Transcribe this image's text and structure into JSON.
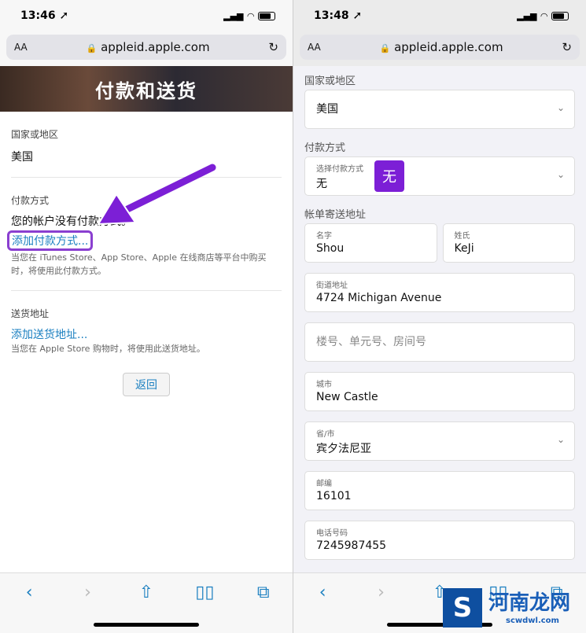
{
  "left": {
    "status": {
      "time": "13:46 ➚"
    },
    "url": {
      "aa": "AA",
      "domain": "appleid.apple.com"
    },
    "banner": "付款和送货",
    "country": {
      "label": "国家或地区",
      "value": "美国"
    },
    "payment": {
      "label": "付款方式",
      "empty": "您的帐户没有付款方式。",
      "add_link": "添加付款方式...",
      "note": "当您在 iTunes Store、App Store、Apple 在线商店等平台中购买时，将使用此付款方式。"
    },
    "shipping": {
      "label": "送货地址",
      "add_link": "添加送货地址...",
      "note": "当您在 Apple Store 购物时，将使用此送货地址。"
    },
    "back_button": "返回",
    "annotation_color": "#8a2be2"
  },
  "right": {
    "status": {
      "time": "13:48 ➚"
    },
    "url": {
      "aa": "AA",
      "domain": "appleid.apple.com"
    },
    "country": {
      "label": "国家或地区",
      "value": "美国"
    },
    "payment": {
      "label": "付款方式",
      "select_label": "选择付款方式",
      "value": "无",
      "badge": "无"
    },
    "billing": {
      "label": "帐单寄送地址",
      "first_name": {
        "label": "名字",
        "value": "Shou"
      },
      "last_name": {
        "label": "姓氏",
        "value": "KeJi"
      },
      "street": {
        "label": "街道地址",
        "value": "4724 Michigan Avenue"
      },
      "unit": {
        "placeholder": "楼号、单元号、房间号"
      },
      "city": {
        "label": "城市",
        "value": "New Castle"
      },
      "state": {
        "label": "省/市",
        "value": "宾夕法尼亚"
      },
      "zip": {
        "label": "邮编",
        "value": "16101"
      },
      "phone": {
        "label": "电话号码",
        "value": "7245987455"
      }
    },
    "watermark": {
      "logo": "S",
      "name": "河南龙网",
      "domain": "scwdwl.com"
    }
  },
  "icons": {
    "back": "‹",
    "forward": "›",
    "share": "⇧",
    "bookmarks": "📖",
    "tabs": "⧉",
    "reload": "↻",
    "lock": "🔒",
    "chevron": "⌄"
  }
}
